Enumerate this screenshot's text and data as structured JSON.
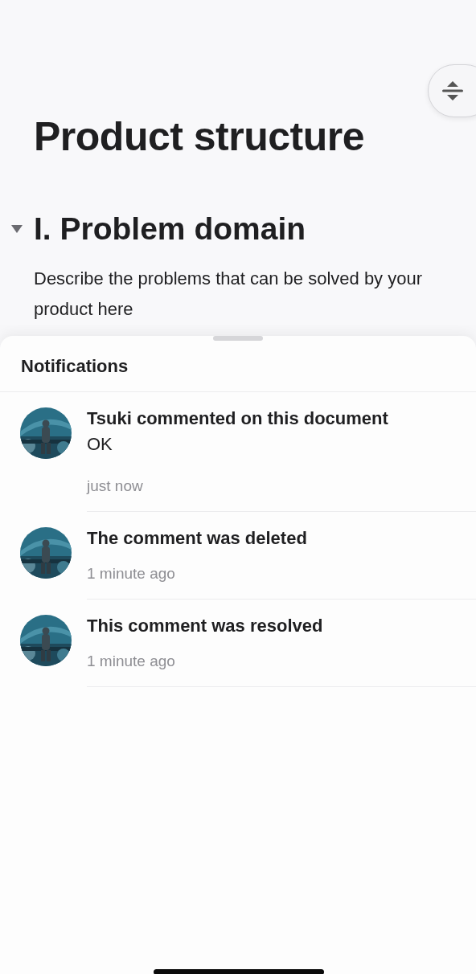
{
  "document": {
    "title": "Product structure",
    "sections": [
      {
        "heading": "I. Problem domain",
        "expanded": true,
        "body": "Describe the problems that can be solved by your product here"
      }
    ]
  },
  "notifications": {
    "title": "Notifications",
    "items": [
      {
        "title": "Tsuki commented on this document",
        "comment": "OK",
        "time": "just now"
      },
      {
        "title": "The comment was deleted",
        "time": "1 minute ago"
      },
      {
        "title": "This comment was resolved",
        "time": "1 minute ago"
      }
    ]
  }
}
